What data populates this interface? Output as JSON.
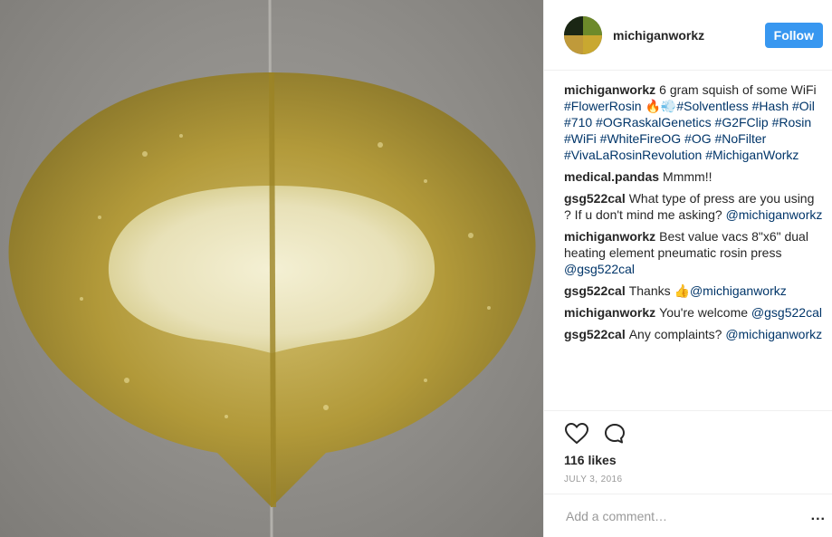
{
  "post": {
    "image_alt": "Rosin squish on parchment paper",
    "username": "michiganworkz",
    "follow_label": "Follow",
    "caption": {
      "username": "michiganworkz",
      "text_parts": [
        {
          "t": "6 gram squish of some WiFi ",
          "tag": false
        },
        {
          "t": "#FlowerRosin",
          "tag": true
        },
        {
          "t": " 🔥💨",
          "tag": false
        },
        {
          "t": "#Solventless",
          "tag": true
        },
        {
          "t": " ",
          "tag": false
        },
        {
          "t": "#Hash",
          "tag": true
        },
        {
          "t": " ",
          "tag": false
        },
        {
          "t": "#Oil",
          "tag": true
        },
        {
          "t": " ",
          "tag": false
        },
        {
          "t": "#710",
          "tag": true
        },
        {
          "t": " ",
          "tag": false
        },
        {
          "t": "#OGRaskalGenetics",
          "tag": true
        },
        {
          "t": " ",
          "tag": false
        },
        {
          "t": "#G2FClip",
          "tag": true
        },
        {
          "t": " ",
          "tag": false
        },
        {
          "t": "#Rosin",
          "tag": true
        },
        {
          "t": " ",
          "tag": false
        },
        {
          "t": "#WiFi",
          "tag": true
        },
        {
          "t": " ",
          "tag": false
        },
        {
          "t": "#WhiteFireOG",
          "tag": true
        },
        {
          "t": " ",
          "tag": false
        },
        {
          "t": "#OG",
          "tag": true
        },
        {
          "t": " ",
          "tag": false
        },
        {
          "t": "#NoFilter",
          "tag": true
        },
        {
          "t": " ",
          "tag": false
        },
        {
          "t": "#VivaLaRosinRevolution",
          "tag": true
        },
        {
          "t": " ",
          "tag": false
        },
        {
          "t": "#MichiganWorkz",
          "tag": true
        }
      ]
    },
    "comments": [
      {
        "user": "medical.pandas",
        "parts": [
          {
            "t": "Mmmm!!",
            "tag": false
          }
        ]
      },
      {
        "user": "gsg522cal",
        "parts": [
          {
            "t": "What type of press are you using ? If u don't mind me asking? ",
            "tag": false
          },
          {
            "t": "@michiganworkz",
            "tag": true
          }
        ]
      },
      {
        "user": "michiganworkz",
        "parts": [
          {
            "t": "Best value vacs 8\"x6\" dual heating element pneumatic rosin press ",
            "tag": false
          },
          {
            "t": "@gsg522cal",
            "tag": true
          }
        ]
      },
      {
        "user": "gsg522cal",
        "parts": [
          {
            "t": "Thanks 👍",
            "tag": false
          },
          {
            "t": "@michiganworkz",
            "tag": true
          }
        ]
      },
      {
        "user": "michiganworkz",
        "parts": [
          {
            "t": "You're welcome ",
            "tag": false
          },
          {
            "t": "@gsg522cal",
            "tag": true
          }
        ]
      },
      {
        "user": "gsg522cal",
        "parts": [
          {
            "t": "Any complaints? ",
            "tag": false
          },
          {
            "t": "@michiganworkz",
            "tag": true
          }
        ]
      }
    ],
    "actions": {
      "like_icon": "heart-outline-icon",
      "comment_icon": "speech-bubble-icon"
    },
    "likes": "116 likes",
    "date": "JULY 3, 2016",
    "add_comment": {
      "placeholder": "Add a comment…",
      "more_label": "..."
    },
    "colors": {
      "accent": "#3897f0",
      "tag": "#003569",
      "muted": "#999999"
    }
  }
}
